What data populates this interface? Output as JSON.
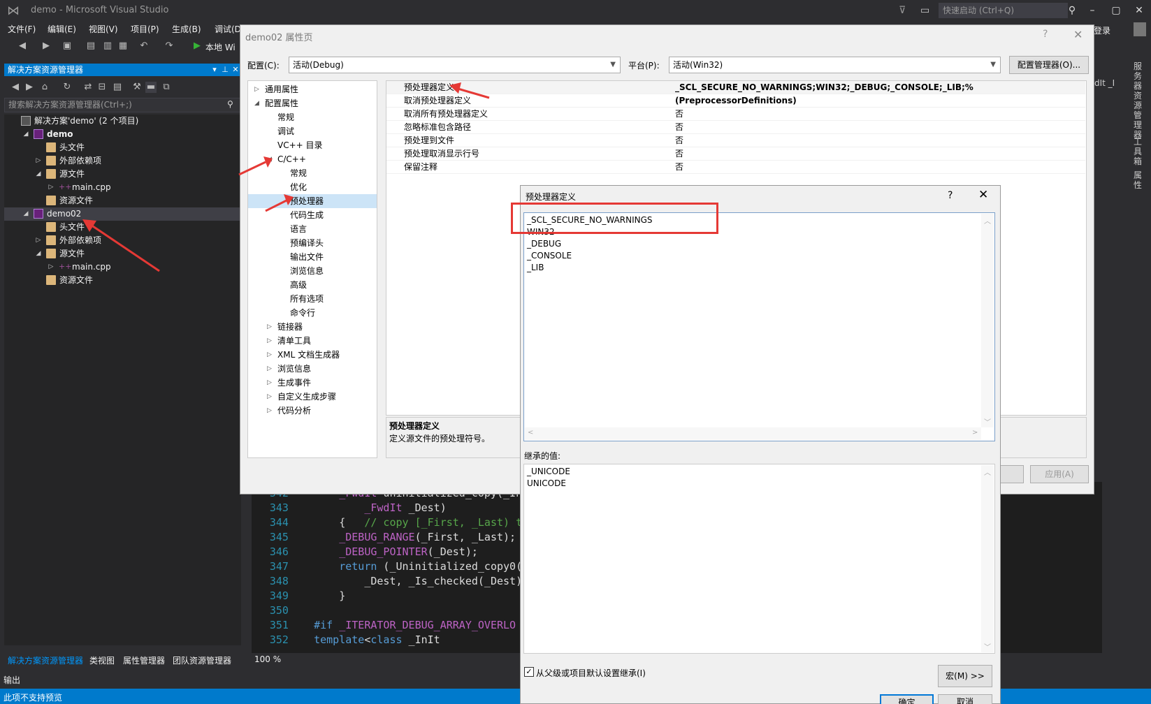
{
  "window": {
    "title": "demo - Microsoft Visual Studio",
    "quick_launch_placeholder": "快速启动 (Ctrl+Q)",
    "login": "登录"
  },
  "menu": [
    "文件(F)",
    "编辑(E)",
    "视图(V)",
    "项目(P)",
    "生成(B)",
    "调试(D"
  ],
  "toolbar": {
    "run_label": "本地 Wi"
  },
  "solution_explorer": {
    "title": "解决方案资源管理器",
    "search_placeholder": "搜索解决方案资源管理器(Ctrl+;)",
    "items": [
      {
        "label": "解决方案'demo' (2 个项目)",
        "level": 0,
        "icon": "sln",
        "arrow": "",
        "bold": false
      },
      {
        "label": "demo",
        "level": 1,
        "icon": "proj",
        "arrow": "◢",
        "bold": true
      },
      {
        "label": "头文件",
        "level": 2,
        "icon": "folder",
        "arrow": "",
        "bold": false
      },
      {
        "label": "外部依赖项",
        "level": 2,
        "icon": "folder",
        "arrow": "▷",
        "bold": false
      },
      {
        "label": "源文件",
        "level": 2,
        "icon": "folder",
        "arrow": "◢",
        "bold": false
      },
      {
        "label": "main.cpp",
        "level": 3,
        "icon": "cpp",
        "arrow": "▷",
        "bold": false
      },
      {
        "label": "资源文件",
        "level": 2,
        "icon": "folder",
        "arrow": "",
        "bold": false
      },
      {
        "label": "demo02",
        "level": 1,
        "icon": "proj",
        "arrow": "◢",
        "bold": false
      },
      {
        "label": "头文件",
        "level": 2,
        "icon": "folder",
        "arrow": "",
        "bold": false
      },
      {
        "label": "外部依赖项",
        "level": 2,
        "icon": "folder",
        "arrow": "▷",
        "bold": false
      },
      {
        "label": "源文件",
        "level": 2,
        "icon": "folder",
        "arrow": "◢",
        "bold": false
      },
      {
        "label": "main.cpp",
        "level": 3,
        "icon": "cpp",
        "arrow": "▷",
        "bold": false
      },
      {
        "label": "资源文件",
        "level": 2,
        "icon": "folder",
        "arrow": "",
        "bold": false
      }
    ],
    "tabs": [
      "解决方案资源管理器",
      "类视图",
      "属性管理器",
      "团队资源管理器"
    ]
  },
  "right_panel_labels": [
    "服务器资源管理器",
    "工具箱",
    "属性"
  ],
  "right_editor_tab": "dIt _I",
  "editor": {
    "zoom": "100 %",
    "lines": [
      {
        "n": "342",
        "parts": [
          [
            "c-normal",
            "    "
          ],
          [
            "c-macro",
            "_FwdIt"
          ],
          [
            "c-normal",
            " uninitialized_copy(_In"
          ]
        ]
      },
      {
        "n": "343",
        "parts": [
          [
            "c-normal",
            "        "
          ],
          [
            "c-macro",
            "_FwdIt"
          ],
          [
            "c-normal",
            " _Dest)"
          ]
        ]
      },
      {
        "n": "344",
        "parts": [
          [
            "c-normal",
            "    {   "
          ],
          [
            "c-cm",
            "// copy [_First, _Last) t"
          ]
        ]
      },
      {
        "n": "345",
        "parts": [
          [
            "c-normal",
            "    "
          ],
          [
            "c-macro",
            "_DEBUG_RANGE"
          ],
          [
            "c-normal",
            "(_First, _Last);"
          ]
        ]
      },
      {
        "n": "346",
        "parts": [
          [
            "c-normal",
            "    "
          ],
          [
            "c-macro",
            "_DEBUG_POINTER"
          ],
          [
            "c-normal",
            "(_Dest);"
          ]
        ]
      },
      {
        "n": "347",
        "parts": [
          [
            "c-normal",
            "    "
          ],
          [
            "c-kw",
            "return"
          ],
          [
            "c-normal",
            " (_Uninitialized_copy0("
          ]
        ]
      },
      {
        "n": "348",
        "parts": [
          [
            "c-normal",
            "        _Dest, _Is_checked(_Dest)"
          ]
        ]
      },
      {
        "n": "349",
        "parts": [
          [
            "c-normal",
            "    }"
          ]
        ]
      },
      {
        "n": "350",
        "parts": [
          [
            "c-normal",
            ""
          ]
        ]
      },
      {
        "n": "351",
        "parts": [
          [
            "c-kw",
            "#if "
          ],
          [
            "c-macro",
            "_ITERATOR_DEBUG_ARRAY_OVERLO"
          ]
        ]
      },
      {
        "n": "352",
        "parts": [
          [
            "c-kw",
            "template"
          ],
          [
            "c-normal",
            "<"
          ],
          [
            "c-kw",
            "class"
          ],
          [
            "c-normal",
            " _InIt"
          ]
        ]
      }
    ]
  },
  "property_dialog": {
    "title": "demo02 属性页",
    "help": "?",
    "config_label": "配置(C):",
    "config_value": "活动(Debug)",
    "platform_label": "平台(P):",
    "platform_value": "活动(Win32)",
    "config_manager_btn": "配置管理器(O)...",
    "tree": [
      {
        "label": "通用属性",
        "level": 0,
        "arrow": "▷"
      },
      {
        "label": "配置属性",
        "level": 0,
        "arrow": "◢"
      },
      {
        "label": "常规",
        "level": 1,
        "arrow": ""
      },
      {
        "label": "调试",
        "level": 1,
        "arrow": ""
      },
      {
        "label": "VC++ 目录",
        "level": 1,
        "arrow": ""
      },
      {
        "label": "C/C++",
        "level": 1,
        "arrow": "◢"
      },
      {
        "label": "常规",
        "level": 2,
        "arrow": ""
      },
      {
        "label": "优化",
        "level": 2,
        "arrow": ""
      },
      {
        "label": "预处理器",
        "level": 2,
        "arrow": "",
        "selected": true
      },
      {
        "label": "代码生成",
        "level": 2,
        "arrow": ""
      },
      {
        "label": "语言",
        "level": 2,
        "arrow": ""
      },
      {
        "label": "预编译头",
        "level": 2,
        "arrow": ""
      },
      {
        "label": "输出文件",
        "level": 2,
        "arrow": ""
      },
      {
        "label": "浏览信息",
        "level": 2,
        "arrow": ""
      },
      {
        "label": "高级",
        "level": 2,
        "arrow": ""
      },
      {
        "label": "所有选项",
        "level": 2,
        "arrow": ""
      },
      {
        "label": "命令行",
        "level": 2,
        "arrow": ""
      },
      {
        "label": "链接器",
        "level": 1,
        "arrow": "▷"
      },
      {
        "label": "清单工具",
        "level": 1,
        "arrow": "▷"
      },
      {
        "label": "XML 文档生成器",
        "level": 1,
        "arrow": "▷"
      },
      {
        "label": "浏览信息",
        "level": 1,
        "arrow": "▷"
      },
      {
        "label": "生成事件",
        "level": 1,
        "arrow": "▷"
      },
      {
        "label": "自定义生成步骤",
        "level": 1,
        "arrow": "▷"
      },
      {
        "label": "代码分析",
        "level": 1,
        "arrow": "▷"
      }
    ],
    "grid": [
      {
        "name": "预处理器定义",
        "value": "_SCL_SECURE_NO_WARNINGS;WIN32;_DEBUG;_CONSOLE;_LIB;%(PreprocessorDefinitions)",
        "bold": true
      },
      {
        "name": "取消预处理器定义",
        "value": ""
      },
      {
        "name": "取消所有预处理器定义",
        "value": "否"
      },
      {
        "name": "忽略标准包含路径",
        "value": "否"
      },
      {
        "name": "预处理到文件",
        "value": "否"
      },
      {
        "name": "预处理取消显示行号",
        "value": "否"
      },
      {
        "name": "保留注释",
        "value": "否"
      }
    ],
    "desc_title": "预处理器定义",
    "desc_text": "定义源文件的预处理符号。",
    "apply_btn": "应用(A)"
  },
  "pp_dialog": {
    "title": "预处理器定义",
    "help": "?",
    "values": [
      "_SCL_SECURE_NO_WARNINGS",
      "WIN32",
      "_DEBUG",
      "_CONSOLE",
      "_LIB"
    ],
    "inherited_label": "继承的值:",
    "inherited": [
      "_UNICODE",
      "UNICODE"
    ],
    "inherit_checkbox": "从父级或项目默认设置继承(I)",
    "inherit_checked": true,
    "macro_btn": "宏(M) >>",
    "ok_btn": "确定",
    "cancel_btn": "取消"
  },
  "status": {
    "output_label": "输出",
    "text": "此项不支持预览"
  },
  "colors": {
    "accent": "#007acc",
    "annotation_red": "#e53935"
  }
}
